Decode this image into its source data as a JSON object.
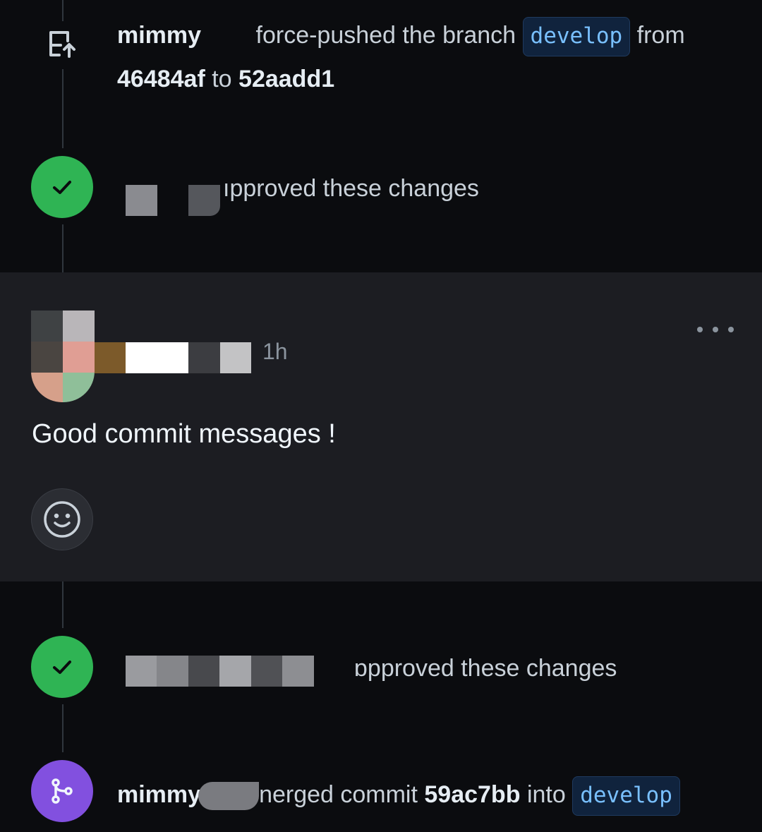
{
  "events": {
    "force_push": {
      "actor": "mimmy",
      "action": "force-pushed the branch",
      "branch": "develop",
      "from_word": "from",
      "from_sha": "46484af",
      "to_word": "to",
      "to_sha": "52aadd1",
      "icon": "repo-push-icon"
    },
    "approval_1": {
      "text": "ıpproved these changes",
      "icon": "check-icon"
    },
    "approval_2": {
      "text": "ɒpproved these changes",
      "icon": "check-icon"
    },
    "merge": {
      "actor": "mimmy",
      "action": "nerged commit",
      "sha": "59ac7bb",
      "into_word": "into",
      "branch": "develop",
      "icon": "git-merge-icon"
    }
  },
  "comment": {
    "time": "1h",
    "body": "Good commit messages !",
    "more_icon": "kebab-horizontal-icon",
    "reaction_icon": "smiley-icon"
  },
  "colors": {
    "success": "#2fb454",
    "merged": "#8250df",
    "branch_text": "#79c0ff",
    "card_bg": "#1c1d22"
  }
}
